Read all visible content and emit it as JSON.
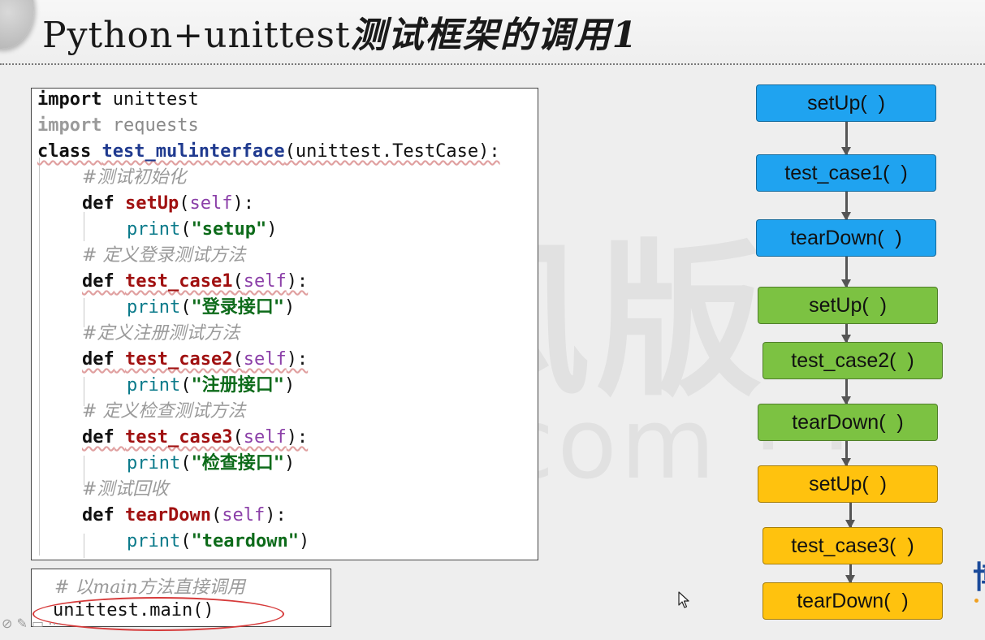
{
  "slide": {
    "title_latin": "Python+unittest",
    "title_cn": "测试框架的调用1",
    "watermark": "千锋风版",
    "watermark_sub": "atstudy.com · ·",
    "corner_logo": "博"
  },
  "code": {
    "lines": [
      {
        "kw": "import",
        "rest": " unittest"
      },
      {
        "kw": "import",
        "rest": " requests"
      },
      {
        "kw": "class",
        "name": "test_mulinterface",
        "rest": "(unittest.TestCase):"
      },
      {
        "comment": "#测试初始化"
      },
      {
        "kw": "def",
        "name": "setUp",
        "open": "(",
        "self": "self",
        "close": "):"
      },
      {
        "builtin": "print",
        "open": "(",
        "str": "\"setup\"",
        "close": ")"
      },
      {
        "comment": "# 定义登录测试方法"
      },
      {
        "kw": "def",
        "name": "test_case1",
        "open": "(",
        "self": "self",
        "close": "):"
      },
      {
        "builtin": "print",
        "open": "(",
        "str": "\"登录接口\"",
        "close": ")"
      },
      {
        "comment": "#定义注册测试方法"
      },
      {
        "kw": "def",
        "name": "test_case2",
        "open": "(",
        "self": "self",
        "close": "):"
      },
      {
        "builtin": "print",
        "open": "(",
        "str": "\"注册接口\"",
        "close": ")"
      },
      {
        "comment": "# 定义检查测试方法"
      },
      {
        "kw": "def",
        "name": "test_case3",
        "open": "(",
        "self": "self",
        "close": "):"
      },
      {
        "builtin": "print",
        "open": "(",
        "str": "\"检查接口\"",
        "close": ")"
      },
      {
        "comment": "#测试回收"
      },
      {
        "kw": "def",
        "name": "tearDown",
        "open": "(",
        "self": "self",
        "close": "):"
      },
      {
        "builtin": "print",
        "open": "(",
        "str": "\"teardown\"",
        "close": ")"
      }
    ],
    "main_comment": "# 以main方法直接调用",
    "main_call": "unittest.main()"
  },
  "flow": {
    "steps": [
      {
        "label": "setUp(  )",
        "group": "blue"
      },
      {
        "label": "test_case1(  )",
        "group": "blue"
      },
      {
        "label": "tearDown(  )",
        "group": "blue"
      },
      {
        "label": "setUp(  )",
        "group": "green"
      },
      {
        "label": "test_case2(  )",
        "group": "green"
      },
      {
        "label": "tearDown(  )",
        "group": "green"
      },
      {
        "label": "setUp(  )",
        "group": "yellow"
      },
      {
        "label": "test_case3(  )",
        "group": "yellow"
      },
      {
        "label": "tearDown(  )",
        "group": "yellow"
      }
    ],
    "colors": {
      "blue": "#1fa3f0",
      "green": "#7cc242",
      "yellow": "#ffc20e"
    }
  }
}
